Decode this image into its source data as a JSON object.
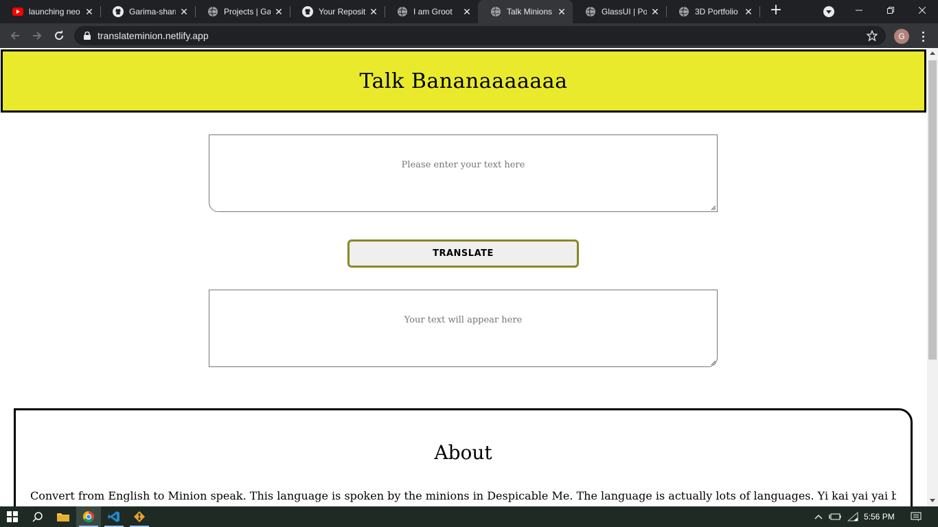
{
  "browser": {
    "tabs": [
      {
        "title": "launching neo",
        "icon": "youtube-icon"
      },
      {
        "title": "Garima-sharm",
        "icon": "github-icon"
      },
      {
        "title": "Projects | Gar",
        "icon": "globe-icon"
      },
      {
        "title": "Your Reposito",
        "icon": "github-icon"
      },
      {
        "title": "I am Groot",
        "icon": "globe-icon"
      },
      {
        "title": "Talk Minions",
        "icon": "globe-icon"
      },
      {
        "title": "GlassUI | Portf",
        "icon": "globe-icon"
      },
      {
        "title": "3D Portfolio",
        "icon": "globe-icon"
      }
    ],
    "active_tab": 5,
    "new_tab_label": "+",
    "url": "translateminion.netlify.app",
    "profile_initial": "G"
  },
  "page": {
    "header_title": "Talk Bananaaaaaaa",
    "input_placeholder": "Please enter your text here",
    "translate_label": "TRANSLATE",
    "output_placeholder": "Your text will appear here",
    "about_title": "About",
    "about_text": "Convert from English to Minion speak. This language is spoken by the minions in Despicable Me. The language is actually lots of languages. Yi kai yai yai bananna! Minion is"
  },
  "taskbar": {
    "time": "5:56 PM"
  },
  "colors": {
    "header_bg": "#eaea2d",
    "button_border": "#888826",
    "chrome_dark": "#202124",
    "chrome_toolbar": "#35363a"
  }
}
